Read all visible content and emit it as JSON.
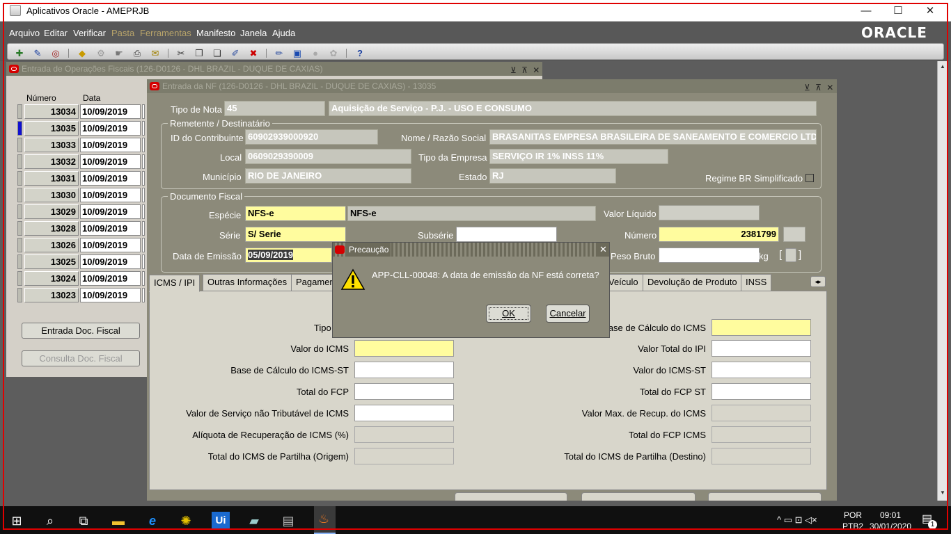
{
  "window": {
    "title": "Aplicativos Oracle - AMEPRJB",
    "minimize": "—",
    "maximize": "☐",
    "close": "✕"
  },
  "menu": [
    "Arquivo",
    "Editar",
    "Verificar",
    "Pasta",
    "Ferramentas",
    "Manifesto",
    "Janela",
    "Ajuda"
  ],
  "brand": "ORACLE",
  "toolbar_icons": [
    "new-record-icon",
    "find-icon",
    "navigator-icon",
    "save-icon",
    "next-step-icon",
    "switch-responsibility-icon",
    "print-icon",
    "close-form-icon",
    "cut-icon",
    "copy-icon",
    "paste-icon",
    "clear-record-icon",
    "delete-record-icon",
    "edit-field-icon",
    "zoom-icon",
    "translations-icon",
    "attachments-icon",
    "folder-tools-icon",
    "help-icon"
  ],
  "back_window": {
    "title": "Entrada de Operações Fiscais (126-D0126 - DHL BRAZIL - DUQUE DE CAXIAS)",
    "col_numero": "Número",
    "col_data": "Data",
    "rows": [
      {
        "numero": "13034",
        "data": "10/09/2019"
      },
      {
        "numero": "13035",
        "data": "10/09/2019"
      },
      {
        "numero": "13033",
        "data": "10/09/2019"
      },
      {
        "numero": "13032",
        "data": "10/09/2019"
      },
      {
        "numero": "13031",
        "data": "10/09/2019"
      },
      {
        "numero": "13030",
        "data": "10/09/2019"
      },
      {
        "numero": "13029",
        "data": "10/09/2019"
      },
      {
        "numero": "13028",
        "data": "10/09/2019"
      },
      {
        "numero": "13026",
        "data": "10/09/2019"
      },
      {
        "numero": "13025",
        "data": "10/09/2019"
      },
      {
        "numero": "13024",
        "data": "10/09/2019"
      },
      {
        "numero": "13023",
        "data": "10/09/2019"
      }
    ],
    "btn_entrada": "Entrada Doc. Fiscal",
    "btn_consulta": "Consulta Doc. Fiscal"
  },
  "nf_window": {
    "title": "Entrada da NF (126-D0126 - DHL BRAZIL - DUQUE DE CAXIAS) - 13035",
    "tipo_nota_label": "Tipo de Nota",
    "tipo_nota_code": "45",
    "tipo_nota_desc": "Aquisição de Serviço - P.J. - USO E CONSUMO",
    "remetente_title": "Remetente / Destinatário",
    "id_contrib_label": "ID do Contribuinte",
    "id_contrib": "60902939000920",
    "razao_label": "Nome / Razão Social",
    "razao": "BRASANITAS EMPRESA BRASILEIRA DE SANEAMENTO E COMERCIO LTD.",
    "local_label": "Local",
    "local": "0609029390009",
    "tipo_empresa_label": "Tipo da Empresa",
    "tipo_empresa": "SERVIÇO IR 1% INSS 11%",
    "municipio_label": "Município",
    "municipio": "RIO DE JANEIRO",
    "estado_label": "Estado",
    "estado": "RJ",
    "regime_label": "Regime BR Simplificado",
    "doc_title": "Documento Fiscal",
    "especie_label": "Espécie",
    "especie_code": "NFS-e",
    "especie_desc": "NFS-e",
    "valor_liquido_label": "Valor Líquido",
    "serie_label": "Série",
    "serie": "S/ Serie",
    "subserie_label": "Subsérie",
    "numero_label": "Número",
    "numero": "2381799",
    "data_emissao_label": "Data de Emissão",
    "data_emissao": "05/09/2019",
    "peso_label": "Peso Bruto",
    "peso_unit": "kg",
    "tabs": [
      "ICMS / IPI",
      "Outras Informações",
      "Pagamen",
      "Veículo",
      "Devolução de Produto",
      "INSS"
    ],
    "left_labels": [
      "Tipo de I",
      "Valor do ICMS",
      "Base de Cálculo do ICMS-ST",
      "Total do FCP",
      "Valor de Serviço não Tributável de ICMS",
      "Alíquota de Recuperação de ICMS (%)",
      "Total do ICMS de Partilha (Origem)"
    ],
    "right_labels": [
      "ase de Cálculo do ICMS",
      "Valor Total do IPI",
      "Valor do ICMS-ST",
      "Total do FCP ST",
      "Valor Max. de Recup. do ICMS",
      "Total do FCP ICMS",
      "Total do ICMS de Partilha (Destino)"
    ]
  },
  "dialog": {
    "title": "Precaução",
    "message": "APP-CLL-00048: A data de emissão da NF está correta?",
    "ok": "OK",
    "cancel": "Cancelar"
  },
  "taskbar": {
    "lang_top": "POR",
    "lang_bottom": "PTB2",
    "time": "09:01",
    "date": "30/01/2020",
    "notif_count": "1"
  }
}
